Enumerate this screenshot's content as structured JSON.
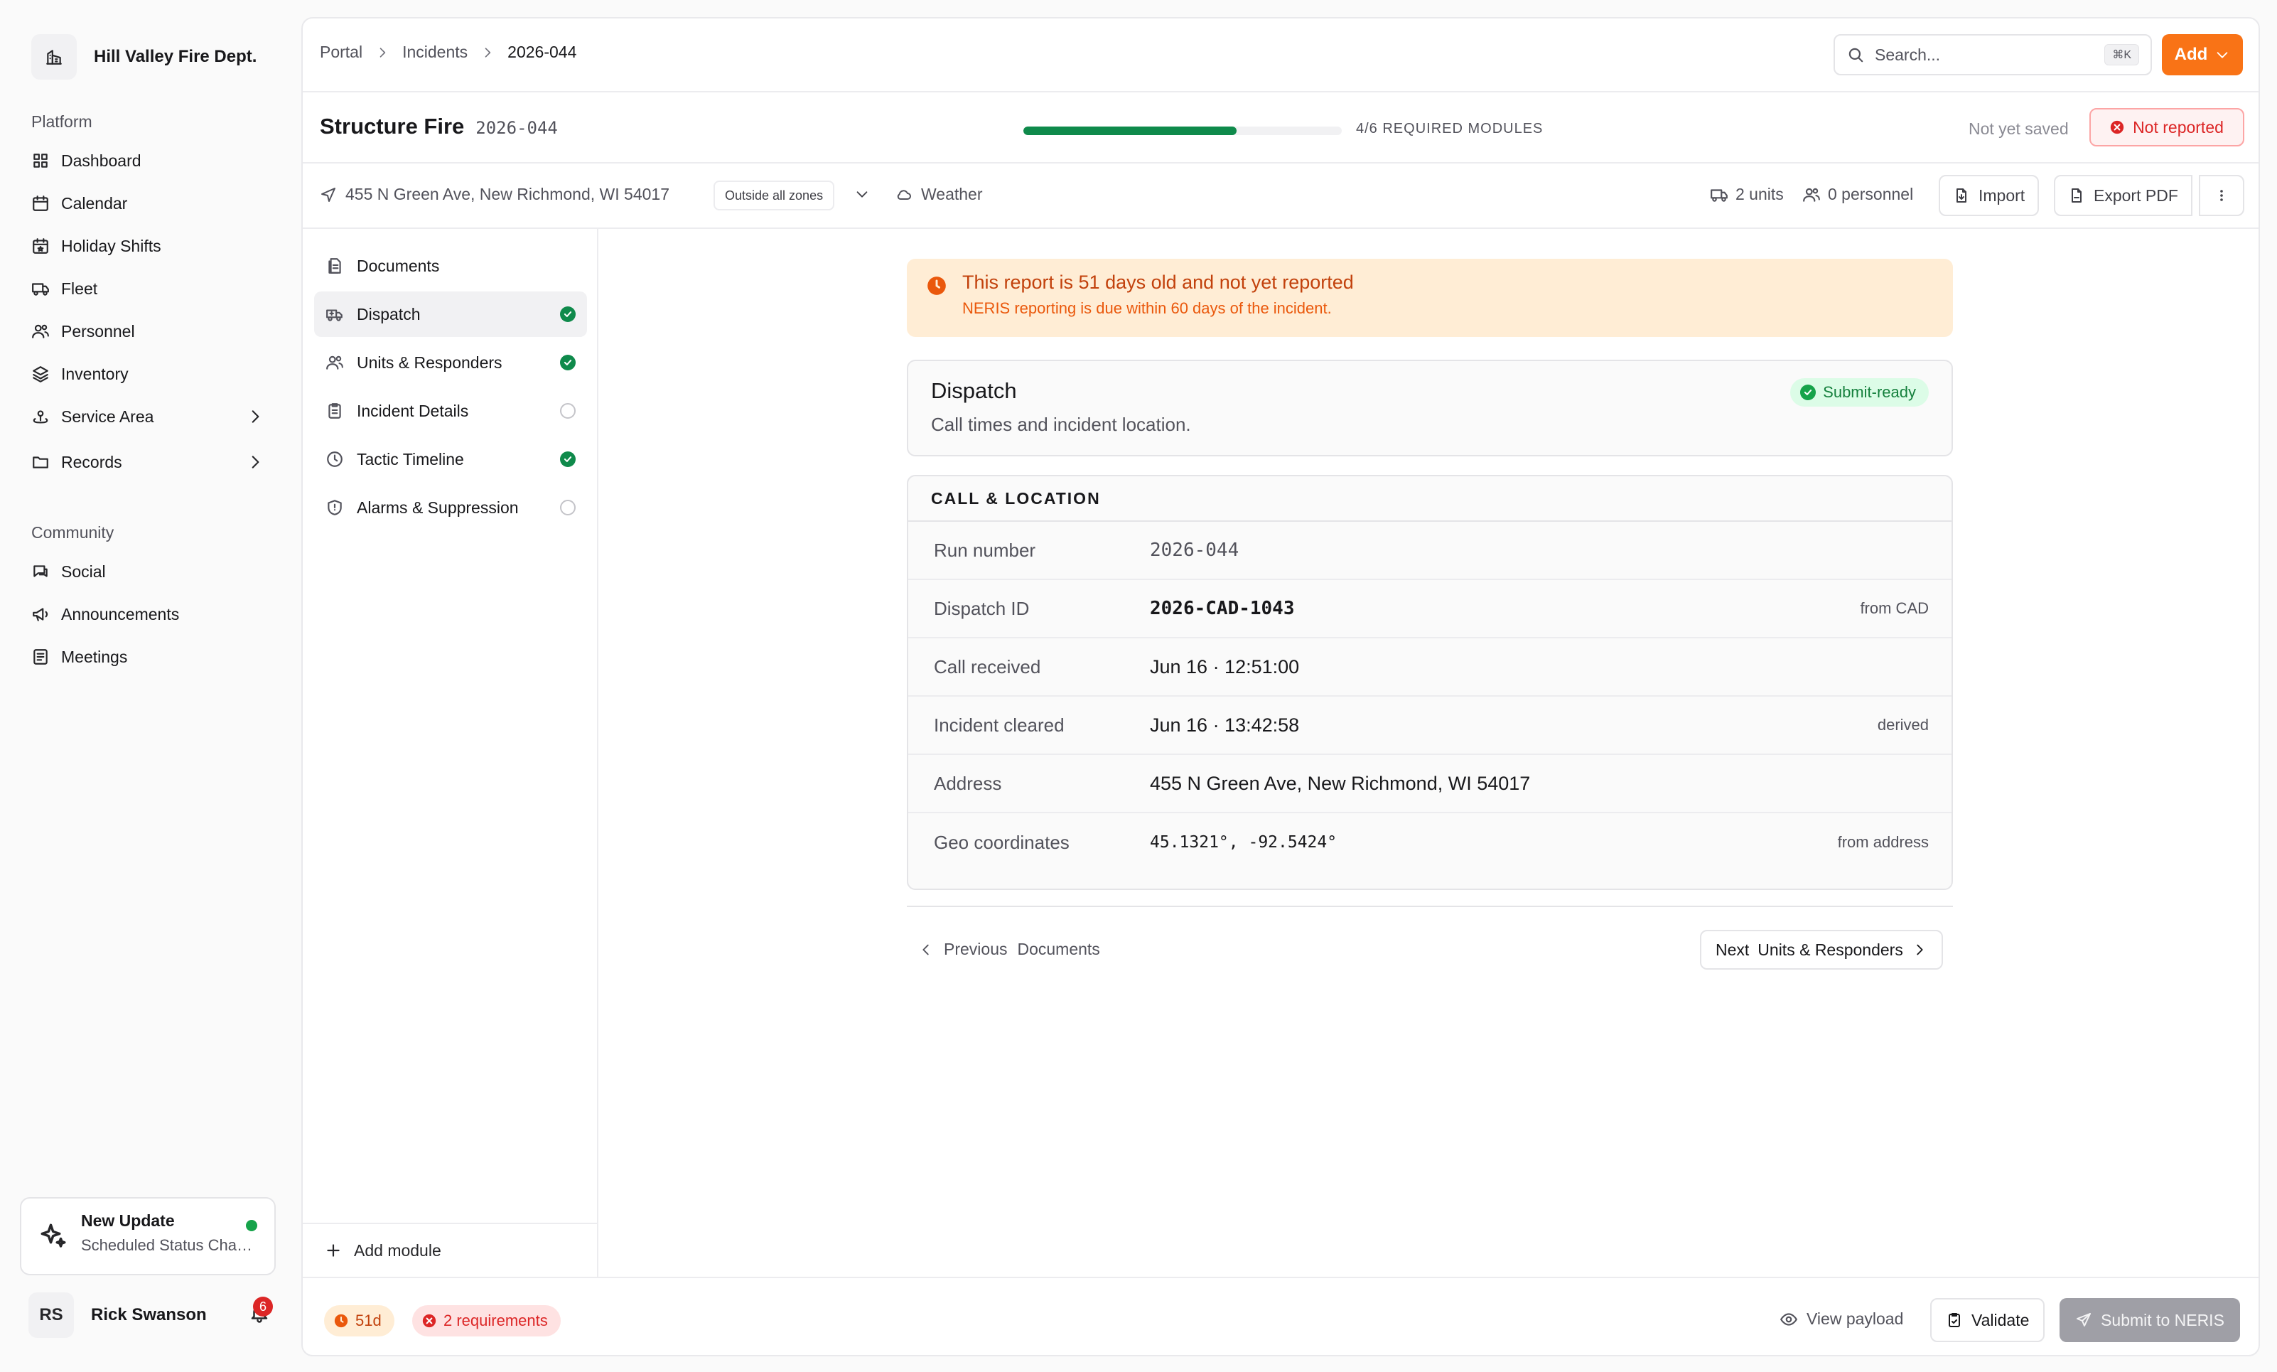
{
  "org": {
    "name": "Hill Valley Fire Dept."
  },
  "nav": {
    "platform_label": "Platform",
    "platform_items": [
      {
        "label": "Dashboard",
        "icon": "grid-icon"
      },
      {
        "label": "Calendar",
        "icon": "calendar-icon"
      },
      {
        "label": "Holiday Shifts",
        "icon": "calendar-star-icon"
      },
      {
        "label": "Fleet",
        "icon": "truck-icon"
      },
      {
        "label": "Personnel",
        "icon": "users-icon"
      },
      {
        "label": "Inventory",
        "icon": "layers-icon"
      },
      {
        "label": "Service Area",
        "icon": "map-pin-icon"
      },
      {
        "label": "Records",
        "icon": "folder-icon"
      }
    ],
    "community_label": "Community",
    "community_items": [
      {
        "label": "Social",
        "icon": "chat-icon"
      },
      {
        "label": "Announcements",
        "icon": "megaphone-icon"
      },
      {
        "label": "Meetings",
        "icon": "list-icon"
      }
    ]
  },
  "update": {
    "title": "New Update",
    "subtitle": "Scheduled Status Changes"
  },
  "user": {
    "initials": "RS",
    "name": "Rick Swanson",
    "notifications": "6"
  },
  "breadcrumbs": {
    "portal": "Portal",
    "incidents": "Incidents",
    "current": "2026-044"
  },
  "search": {
    "placeholder": "Search...",
    "shortcut": "⌘K"
  },
  "add_button": "Add",
  "incident": {
    "title": "Structure Fire",
    "run_number": "2026-044",
    "progress_fraction": 0.67,
    "progress_label": "4/6 REQUIRED MODULES",
    "save_status": "Not yet saved",
    "report_status": "Not reported",
    "address": "455 N Green Ave, New Richmond, WI 54017",
    "zone": "Outside all zones",
    "weather": "Weather",
    "units": "2 units",
    "personnel": "0 personnel",
    "import_label": "Import",
    "export_label": "Export PDF"
  },
  "modules": [
    {
      "label": "Documents",
      "status": "none",
      "icon": "document-icon"
    },
    {
      "label": "Dispatch",
      "status": "done",
      "icon": "ambulance-icon"
    },
    {
      "label": "Units & Responders",
      "status": "done",
      "icon": "users-icon"
    },
    {
      "label": "Incident Details",
      "status": "empty",
      "icon": "clipboard-icon"
    },
    {
      "label": "Tactic Timeline",
      "status": "done",
      "icon": "clock-icon"
    },
    {
      "label": "Alarms & Suppression",
      "status": "empty",
      "icon": "shield-icon"
    }
  ],
  "add_module": "Add module",
  "alert": {
    "title": "This report is 51 days old and not yet reported",
    "subtitle": "NERIS reporting is due within 60 days of the incident."
  },
  "section": {
    "title": "Dispatch",
    "subtitle": "Call times and incident location.",
    "badge": "Submit-ready"
  },
  "table": {
    "header": "CALL & LOCATION",
    "rows": [
      {
        "label": "Run number",
        "value": "2026-044",
        "hint": ""
      },
      {
        "label": "Dispatch ID",
        "value": "2026-CAD-1043",
        "hint": "from CAD"
      },
      {
        "label": "Call received",
        "value": "Jun 16 · 12:51:00",
        "hint": ""
      },
      {
        "label": "Incident cleared",
        "value": "Jun 16 · 13:42:58",
        "hint": "derived"
      },
      {
        "label": "Address",
        "value": "455 N Green Ave, New Richmond, WI 54017",
        "hint": ""
      },
      {
        "label": "Geo coordinates",
        "value": "45.1321°, -92.5424°",
        "hint": "from address"
      }
    ]
  },
  "pager": {
    "prev_word": "Previous",
    "prev_target": "Documents",
    "next_word": "Next",
    "next_target": "Units & Responders"
  },
  "footer": {
    "days_chip": "51d",
    "requirements_chip": "2 requirements",
    "view_payload": "View payload",
    "validate": "Validate",
    "submit": "Submit to NERIS"
  },
  "colors": {
    "accent": "#f97316",
    "success": "#0f8a4b",
    "danger": "#dc2626",
    "warning_bg": "#ffedd5"
  }
}
